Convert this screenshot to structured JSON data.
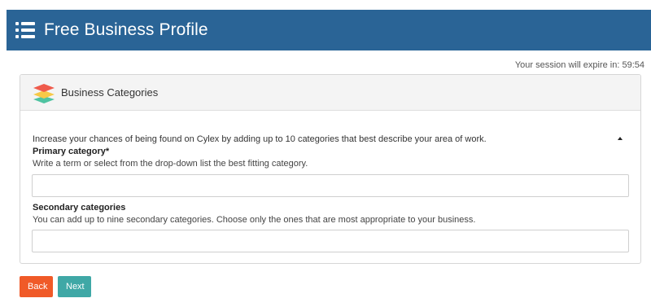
{
  "header": {
    "title": "Free Business Profile",
    "icon": "list-icon",
    "color": "#2a6496"
  },
  "session": {
    "text": "Your session will expire in: 59:54"
  },
  "panel": {
    "title": "Business Categories",
    "icon": "layers-icon",
    "intro": "Increase your chances of being found on Cylex by adding up to 10 categories that best describe your area of work.",
    "primary": {
      "label": "Primary category*",
      "help": "Write a term or select from the drop-down list the best fitting category.",
      "value": ""
    },
    "secondary": {
      "label": "Secondary categories",
      "help": "You can add up to nine secondary categories. Choose only the ones that are most appropriate to your business.",
      "value": ""
    }
  },
  "buttons": {
    "back": "Back",
    "next": "Next",
    "back_color": "#f05a28",
    "next_color": "#3fa8a6"
  }
}
